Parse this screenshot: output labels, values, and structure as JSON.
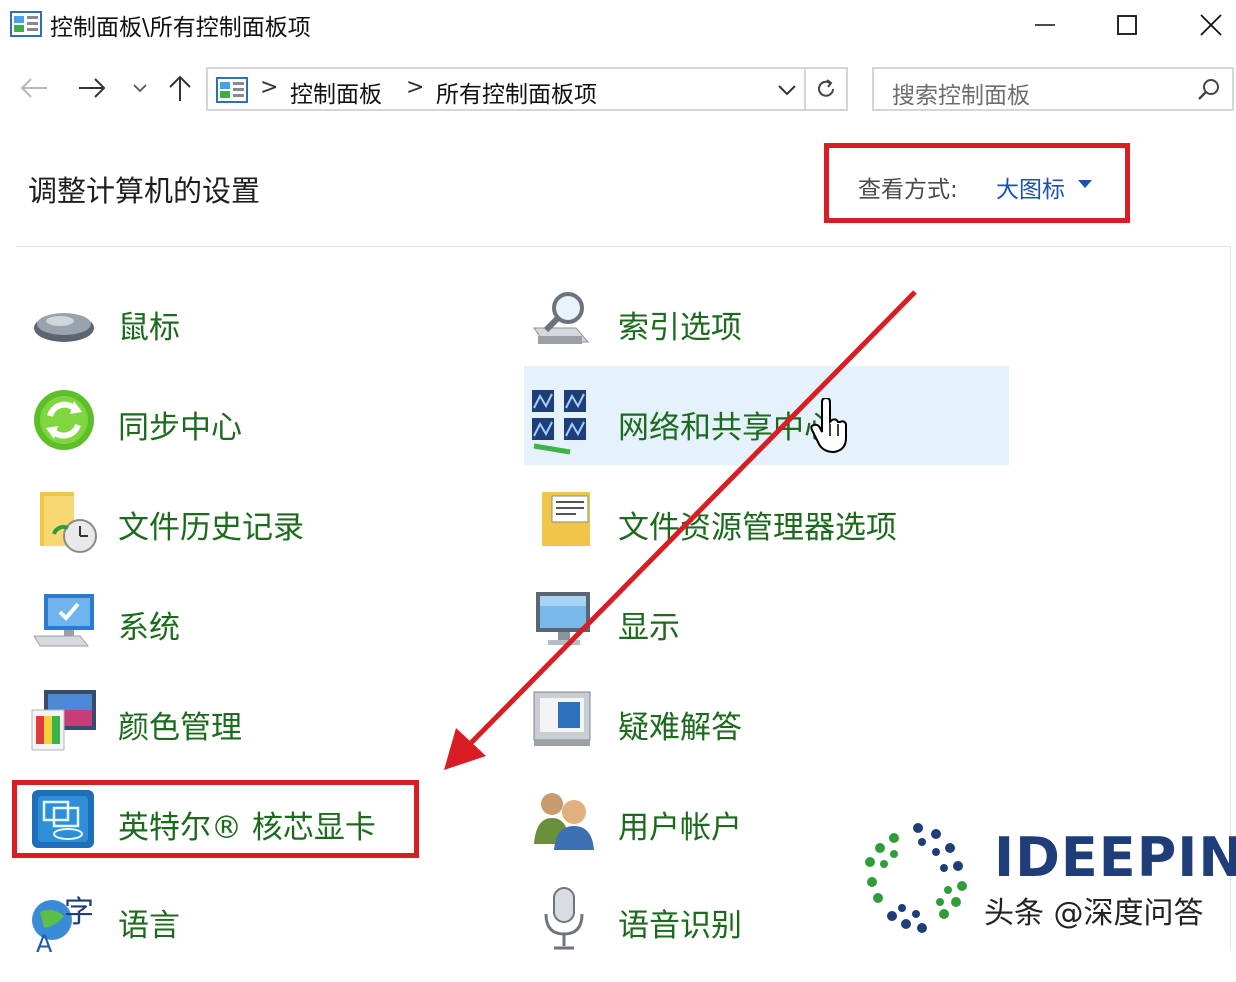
{
  "window": {
    "title": "控制面板\\所有控制面板项"
  },
  "nav": {
    "breadcrumb": [
      "控制面板",
      "所有控制面板项"
    ],
    "breadcrumb_separator": ">",
    "search_placeholder": "搜索控制面板"
  },
  "header": {
    "title": "调整计算机的设置",
    "view_label": "查看方式:",
    "view_value": "大图标"
  },
  "items": [
    {
      "label": "鼠标",
      "icon": "mouse-icon"
    },
    {
      "label": "索引选项",
      "icon": "indexing-options-icon"
    },
    {
      "label": "同步中心",
      "icon": "sync-center-icon"
    },
    {
      "label": "网络和共享中心",
      "icon": "network-sharing-icon",
      "hovered": true
    },
    {
      "label": "文件历史记录",
      "icon": "file-history-icon"
    },
    {
      "label": "文件资源管理器选项",
      "icon": "file-explorer-options-icon"
    },
    {
      "label": "系统",
      "icon": "system-icon"
    },
    {
      "label": "显示",
      "icon": "display-icon"
    },
    {
      "label": "颜色管理",
      "icon": "color-management-icon"
    },
    {
      "label": "疑难解答",
      "icon": "troubleshooting-icon"
    },
    {
      "label": "英特尔® 核芯显卡",
      "icon": "intel-graphics-icon",
      "highlighted": true
    },
    {
      "label": "用户帐户",
      "icon": "user-accounts-icon"
    },
    {
      "label": "语言",
      "icon": "language-icon"
    },
    {
      "label": "语音识别",
      "icon": "speech-recognition-icon"
    }
  ],
  "annotations": {
    "highlight_color": "#d81d24",
    "link_color": "#1c6b1c"
  },
  "watermark": {
    "brand": "IDEEPIN",
    "credit": "头条 @深度问答"
  }
}
